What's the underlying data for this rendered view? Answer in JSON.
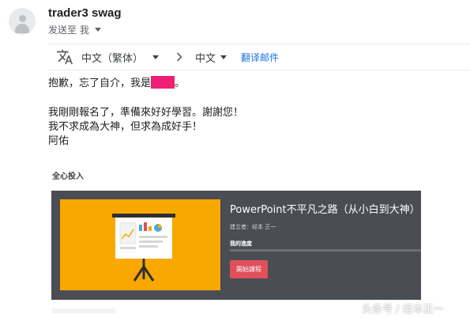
{
  "email": {
    "sender_name": "trader3 swag",
    "recipient_text": "发送至 我"
  },
  "translate_bar": {
    "source_lang": "中文（繁体）",
    "target_lang": "中文",
    "translate_link": "翻译邮件"
  },
  "message": {
    "line1_prefix": "抱歉，忘了自介，我是",
    "line1_suffix": "。",
    "line2": "我剛剛報名了，準備來好好學習。謝謝您！",
    "line3": "我不求成為大神，但求為成好手！",
    "line4": "阿佑"
  },
  "course_card": {
    "heading": "全心投入",
    "title": "PowerPoint不平凡之路（从小白到大神）",
    "creator": "建立者：经本 正一",
    "progress_label": "我的進度",
    "progress": 0,
    "button_label": "開始課程"
  },
  "watermark": "头条号 / 经本正一",
  "colors": {
    "redaction": "#ee1f74",
    "card_bg": "#4b4d55",
    "thumb_bg": "#f9a800",
    "button": "#e04f5a",
    "link": "#1a73e8"
  }
}
